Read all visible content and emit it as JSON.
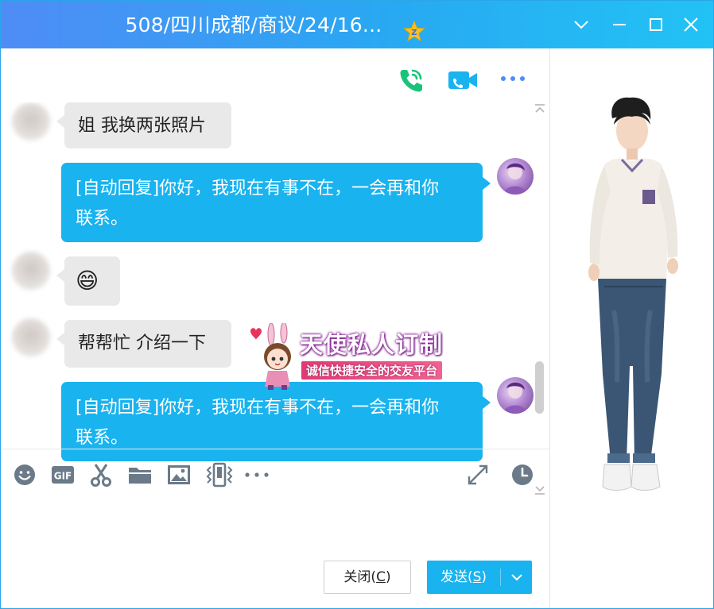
{
  "window": {
    "title": "508/四川成都/商议/24/16...",
    "controls": [
      "chevron-down",
      "minimize",
      "maximize",
      "close"
    ]
  },
  "top_actions": [
    "phone-call",
    "video-call",
    "more"
  ],
  "messages": [
    {
      "side": "in",
      "text": "姐 我换两张照片"
    },
    {
      "side": "out",
      "line1": "[自动回复]你好，我现在有事不在，一会再和你",
      "line2": "联系。"
    },
    {
      "side": "in",
      "text": "😄"
    },
    {
      "side": "in",
      "text": "帮帮忙 介绍一下"
    },
    {
      "side": "out",
      "line1": "[自动回复]你好，我现在有事不在，一会再和你",
      "line2": "联系。"
    }
  ],
  "ad": {
    "title": "天使私人订制",
    "subtitle": "诚信快捷安全的交友平台"
  },
  "toolbar": [
    "emoji",
    "gif",
    "screenshot",
    "file",
    "image",
    "shake",
    "more",
    "expand",
    "history"
  ],
  "buttons": {
    "close": {
      "label": "关闭(",
      "key": "C",
      "suffix": ")"
    },
    "send": {
      "label": "发送(",
      "key": "S",
      "suffix": ")"
    }
  },
  "colors": {
    "accent": "#19b3ef",
    "title_gradient_start": "#4f8cf6",
    "title_gradient_end": "#22c2f5",
    "bubble_in": "#e9e9e9"
  }
}
